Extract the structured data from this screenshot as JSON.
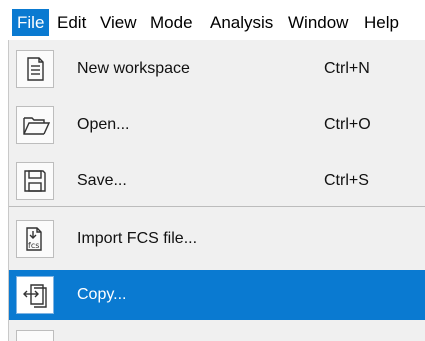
{
  "menubar": {
    "items": [
      {
        "label": "File",
        "active": true
      },
      {
        "label": "Edit"
      },
      {
        "label": "View"
      },
      {
        "label": "Mode"
      },
      {
        "label": "Analysis"
      },
      {
        "label": "Window"
      },
      {
        "label": "Help"
      }
    ]
  },
  "file_menu": {
    "items": [
      {
        "label": "New workspace",
        "shortcut": "Ctrl+N",
        "icon": "new-document-icon"
      },
      {
        "label": "Open...",
        "shortcut": "Ctrl+O",
        "icon": "folder-open-icon"
      },
      {
        "label": "Save...",
        "shortcut": "Ctrl+S",
        "icon": "floppy-disk-icon"
      },
      {
        "label": "Import FCS file...",
        "shortcut": "",
        "icon": "fcs-file-icon"
      },
      {
        "label": "Copy...",
        "shortcut": "",
        "icon": "copy-documents-icon",
        "selected": true
      }
    ]
  },
  "colors": {
    "accent": "#0a7ad1",
    "menu_background": "#f0f0f0"
  }
}
